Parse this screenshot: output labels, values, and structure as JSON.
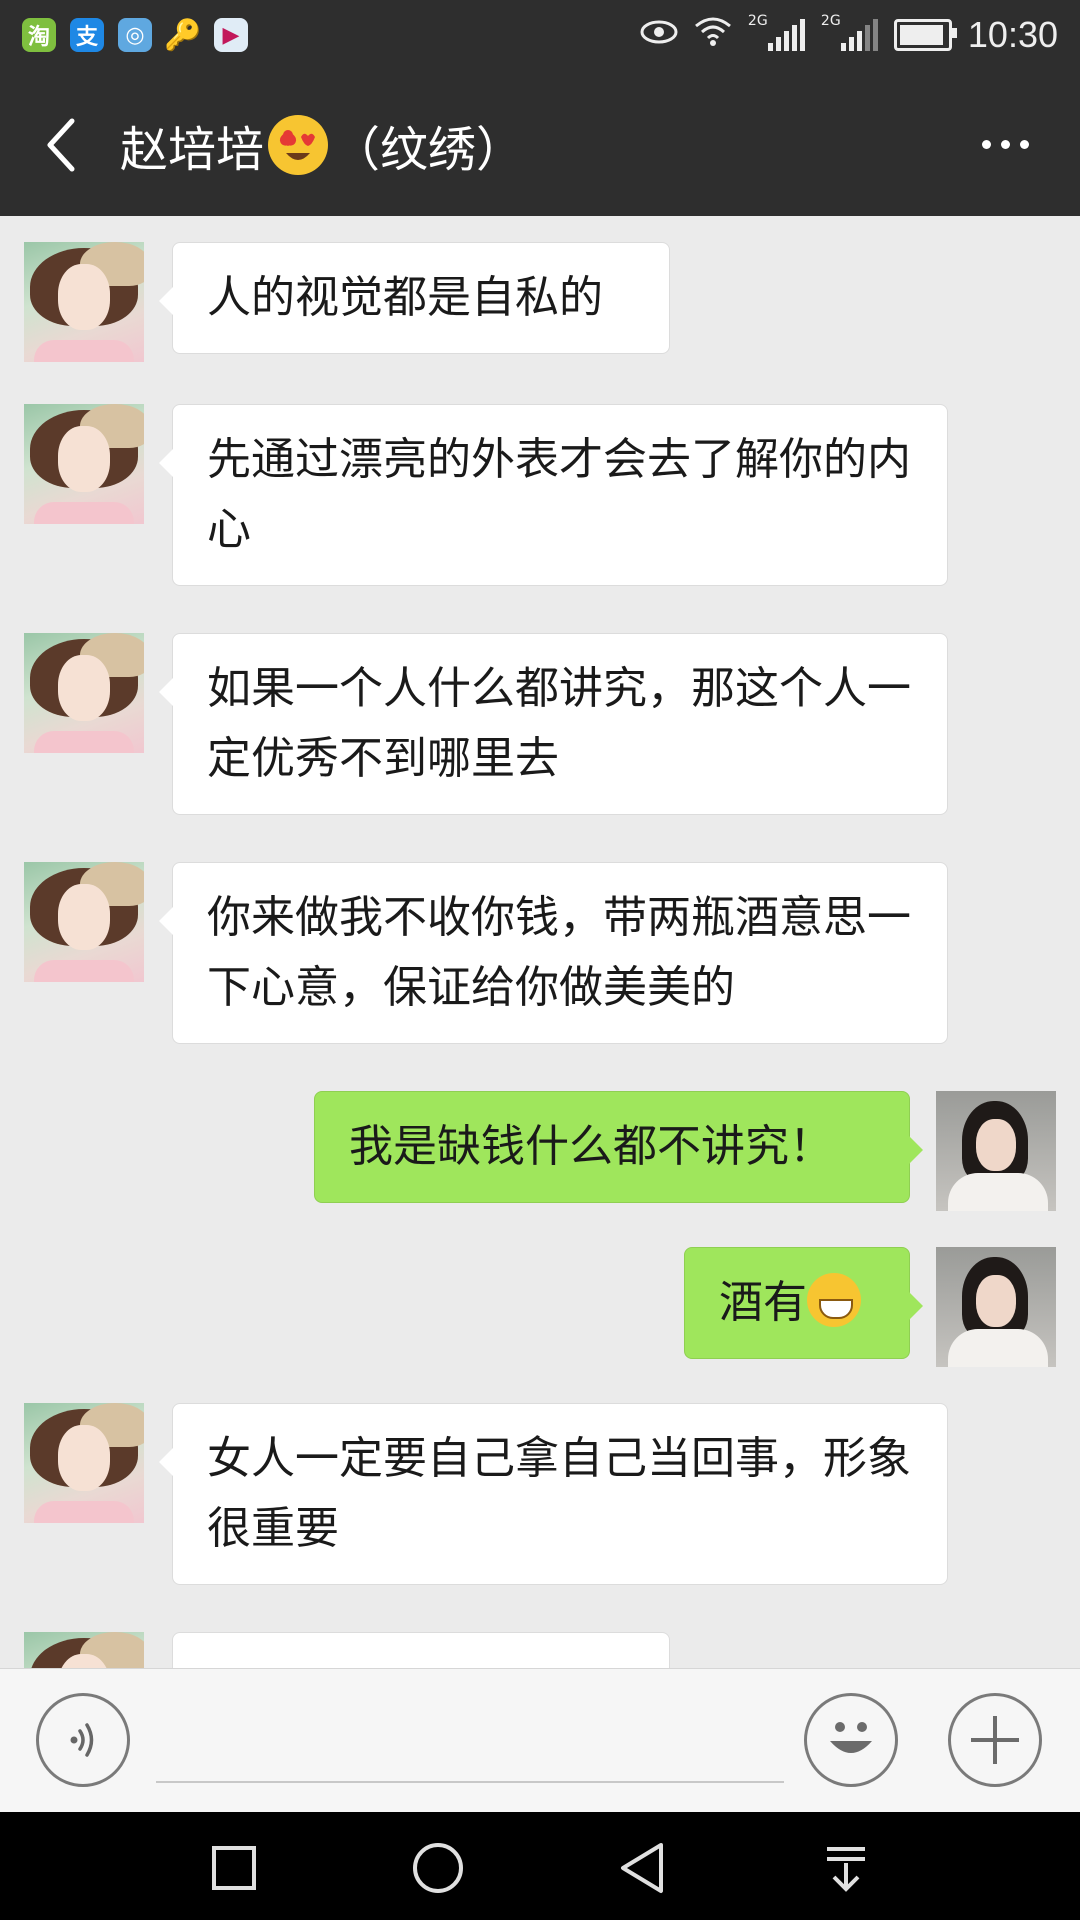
{
  "status_bar": {
    "app_icons": [
      "taobao-icon",
      "alipay-icon",
      "browser-icon",
      "key-icon",
      "video-icon"
    ],
    "app_icon_glyphs": [
      "淘",
      "支",
      "◎",
      "🔑",
      "▶"
    ],
    "network_label_1": "2G",
    "network_label_2": "2G",
    "time": "10:30"
  },
  "header": {
    "title_prefix": "赵培培",
    "title_suffix": "（纹绣）",
    "back_icon": "chevron-left-icon",
    "more_icon": "more-dots-icon"
  },
  "colors": {
    "header_bg": "#2e2e2e",
    "chat_bg": "#ebebeb",
    "incoming_bubble": "#ffffff",
    "outgoing_bubble": "#9fe65c"
  },
  "messages": [
    {
      "side": "left",
      "text": "人的视觉都是自私的"
    },
    {
      "side": "left",
      "text": "先通过漂亮的外表才会去了解你的内心"
    },
    {
      "side": "left",
      "text": "如果一个人什么都讲究，那这个人一定优秀不到哪里去"
    },
    {
      "side": "left",
      "text": "你来做我不收你钱，带两瓶酒意思一下心意，保证给你做美美的"
    },
    {
      "side": "right",
      "text": "我是缺钱什么都不讲究！"
    },
    {
      "side": "right",
      "text": "酒有"
    },
    {
      "side": "left",
      "text": "女人一定要自己拿自己当回事，形象很重要"
    },
    {
      "side": "left",
      "text": ""
    }
  ],
  "input_bar": {
    "voice_icon": "voice-icon",
    "emoji_icon": "emoji-icon",
    "plus_icon": "plus-icon",
    "text_value": ""
  },
  "nav_bar": {
    "icons": [
      "recent-apps-icon",
      "home-icon",
      "back-icon",
      "notification-pull-icon"
    ]
  }
}
